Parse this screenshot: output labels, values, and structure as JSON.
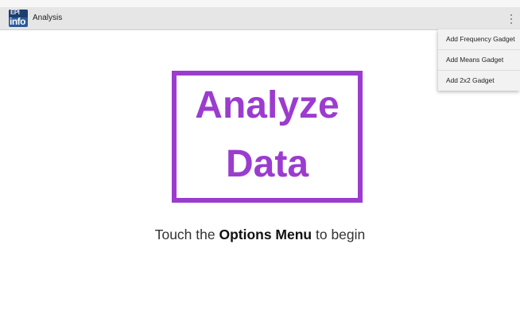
{
  "actionbar": {
    "title": "Analysis",
    "icon": "epi-info-app-icon",
    "icon_text_top": "EPI",
    "icon_text_bottom": "info"
  },
  "menu": {
    "items": [
      {
        "label": "Add Frequency Gadget"
      },
      {
        "label": "Add Means Gadget"
      },
      {
        "label": "Add 2x2 Gadget"
      }
    ]
  },
  "logo": {
    "line1": "Analyze",
    "line2": "Data",
    "color": "#9b3ccf"
  },
  "instruction": {
    "prefix": "Touch the ",
    "bold": "Options Menu",
    "suffix": " to begin"
  }
}
